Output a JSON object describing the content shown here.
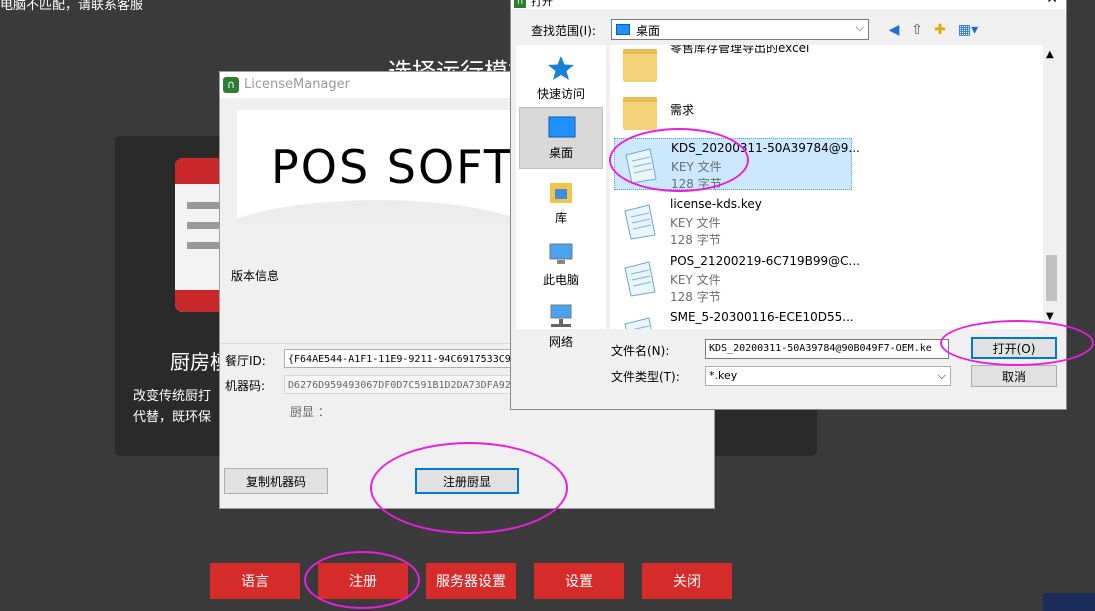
{
  "background": {
    "notice": "电脑不匹配，请联系客服",
    "heading": "选择运行模式",
    "kds_card": {
      "title": "厨房模式",
      "desc_line1": "改变传统厨打",
      "desc_line2": "代替，既环保"
    },
    "buttons": {
      "language": "语言",
      "register": "注册",
      "server_settings": "服务器设置",
      "settings": "设置",
      "close": "关闭"
    }
  },
  "license_manager": {
    "title": "LicenseManager",
    "banner_text": "POS SOFT",
    "version_label": "版本信息",
    "restaurant_id_label": "餐厅ID:",
    "restaurant_id_value": "{F64AE544-A1F1-11E9-9211-94C6917533C9",
    "machine_code_label": "机器码:",
    "machine_code_value": "D6276D959493067DF0D7C591B1D2DA73DFA92",
    "kds_label": "厨显 ：",
    "copy_button": "复制机器码",
    "register_kds_button": "注册厨显"
  },
  "open_dialog": {
    "title": "打开",
    "close_glyph": "✕",
    "look_in_label": "查找范围(I):",
    "look_in_value": "桌面",
    "places": [
      {
        "label": "快速访问"
      },
      {
        "label": "桌面"
      },
      {
        "label": "库"
      },
      {
        "label": "此电脑"
      },
      {
        "label": "网络"
      }
    ],
    "files": [
      {
        "name": "零售库存管理导出的excel",
        "type": "",
        "size": ""
      },
      {
        "name": "需求",
        "type": "",
        "size": ""
      },
      {
        "name": "KDS_20200311-50A39784@9...",
        "type": "KEY 文件",
        "size": "128 字节"
      },
      {
        "name": "license-kds.key",
        "type": "KEY 文件",
        "size": "128 字节"
      },
      {
        "name": "POS_21200219-6C719B99@C...",
        "type": "KEY 文件",
        "size": "128 字节"
      },
      {
        "name": "SME_5-20300116-ECE10D55...",
        "type": "",
        "size": ""
      }
    ],
    "filename_label": "文件名(N):",
    "filename_value": "KDS_20200311-50A39784@90B049F7-OEM.ke",
    "filetype_label": "文件类型(T):",
    "filetype_value": "*.key",
    "open_button": "打开(O)",
    "cancel_button": "取消"
  },
  "colors": {
    "accent_red": "#d52b2b",
    "annotation": "#e81ee0",
    "selection": "#cce8ff",
    "focus_blue": "#0078d7"
  }
}
